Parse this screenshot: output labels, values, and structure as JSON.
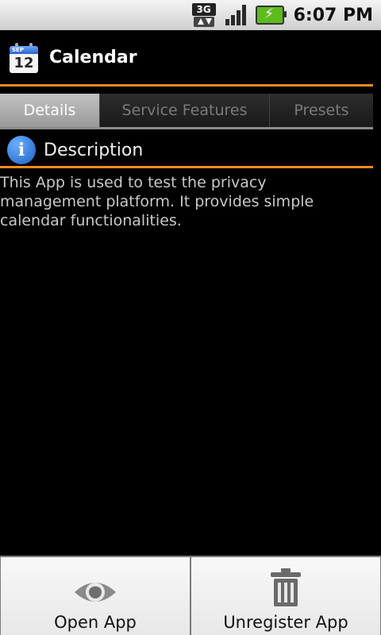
{
  "status_bar": {
    "network_type": "3G",
    "time": "6:07 PM",
    "icons": [
      "3g-data-icon",
      "signal-strength-icon",
      "battery-charging-icon"
    ]
  },
  "header": {
    "app_icon": "calendar-icon",
    "app_icon_month": "SEP",
    "app_icon_day": "12",
    "title": "Calendar"
  },
  "tabs": [
    {
      "label": "Details",
      "active": true
    },
    {
      "label": "Service Features",
      "active": false
    },
    {
      "label": "Presets",
      "active": false
    }
  ],
  "description": {
    "icon": "info-icon",
    "heading": "Description",
    "text": "This App is used to test the privacy management platform. It provides simple calendar functionalities."
  },
  "actions": [
    {
      "label": "Open App",
      "icon": "eye-icon"
    },
    {
      "label": "Unregister App",
      "icon": "trash-icon"
    }
  ],
  "colors": {
    "accent": "#f08a1c",
    "background": "#000000",
    "active_tab": "#b0b0b0"
  }
}
